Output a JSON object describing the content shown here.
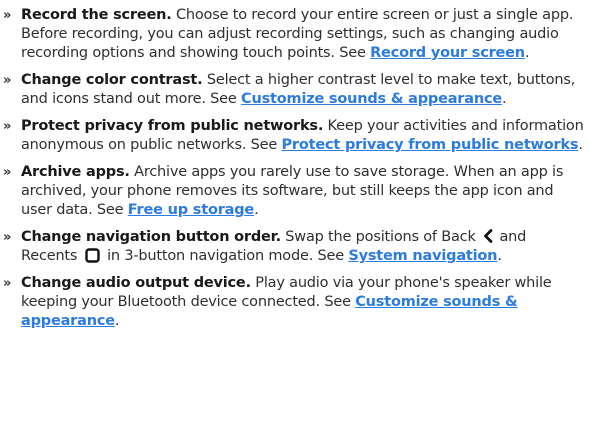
{
  "items": [
    {
      "bullet": "»",
      "title": "Record the screen.",
      "text": " Choose to record your entire screen or just a single app. Before recording, you can adjust recording settings, such as changing audio recording options and showing touch points. See ",
      "link": "Record your screen",
      "end": "."
    },
    {
      "bullet": "»",
      "title": "Change color contrast.",
      "text": " Select a higher contrast level to make text, buttons, and icons stand out more. See ",
      "link": "Customize sounds & appearance",
      "end": "."
    },
    {
      "bullet": "»",
      "title": "Protect privacy from public networks.",
      "text": " Keep your activities and information anonymous on public networks. See ",
      "link": "Protect privacy from public networks",
      "end": "."
    },
    {
      "bullet": "»",
      "title": "Archive apps.",
      "text": " Archive apps you rarely use to save storage. When an app is archived, your phone removes its software, but still keeps the app icon and user data. See ",
      "link": "Free up storage",
      "end": "."
    },
    {
      "bullet": "»",
      "title": "Change navigation button order.",
      "text_a": " Swap the positions of Back ",
      "icon_a": "back-chevron-icon",
      "text_b": " and Recents ",
      "icon_b": "recents-square-icon",
      "text_c": " in 3-button navigation mode. See ",
      "link": "System navigation",
      "end": "."
    },
    {
      "bullet": "»",
      "title": "Change audio output device.",
      "text": " Play audio via your phone's speaker while keeping your Bluetooth device connected. See ",
      "link": "Customize sounds & appearance",
      "end": "."
    }
  ],
  "colors": {
    "link": "#2b7be0",
    "text": "#2f2f2f",
    "title": "#1a1a1a"
  }
}
